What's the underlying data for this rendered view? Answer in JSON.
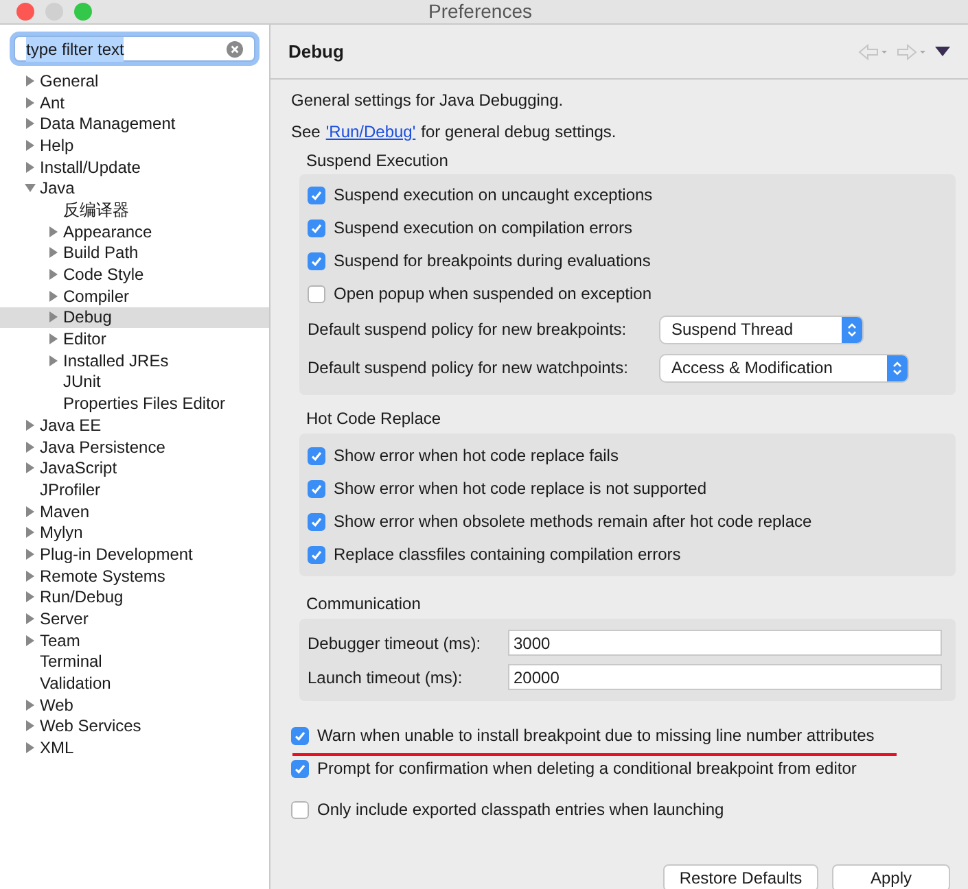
{
  "window": {
    "title": "Preferences"
  },
  "filter": {
    "value": "type filter text"
  },
  "tree": [
    {
      "label": "General",
      "kind": "branch",
      "expanded": false,
      "selected": false
    },
    {
      "label": "Ant",
      "kind": "branch",
      "expanded": false,
      "selected": false
    },
    {
      "label": "Data Management",
      "kind": "branch",
      "expanded": false,
      "selected": false
    },
    {
      "label": "Help",
      "kind": "branch",
      "expanded": false,
      "selected": false
    },
    {
      "label": "Install/Update",
      "kind": "branch",
      "expanded": false,
      "selected": false
    },
    {
      "label": "Java",
      "kind": "branch",
      "expanded": true,
      "selected": false,
      "children": [
        {
          "label": "反编译器",
          "kind": "leaf",
          "selected": false
        },
        {
          "label": "Appearance",
          "kind": "branch",
          "expanded": false,
          "selected": false
        },
        {
          "label": "Build Path",
          "kind": "branch",
          "expanded": false,
          "selected": false
        },
        {
          "label": "Code Style",
          "kind": "branch",
          "expanded": false,
          "selected": false
        },
        {
          "label": "Compiler",
          "kind": "branch",
          "expanded": false,
          "selected": false
        },
        {
          "label": "Debug",
          "kind": "branch",
          "expanded": false,
          "selected": true
        },
        {
          "label": "Editor",
          "kind": "branch",
          "expanded": false,
          "selected": false
        },
        {
          "label": "Installed JREs",
          "kind": "branch",
          "expanded": false,
          "selected": false
        },
        {
          "label": "JUnit",
          "kind": "leaf",
          "selected": false
        },
        {
          "label": "Properties Files Editor",
          "kind": "leaf",
          "selected": false
        }
      ]
    },
    {
      "label": "Java EE",
      "kind": "branch",
      "expanded": false,
      "selected": false
    },
    {
      "label": "Java Persistence",
      "kind": "branch",
      "expanded": false,
      "selected": false
    },
    {
      "label": "JavaScript",
      "kind": "branch",
      "expanded": false,
      "selected": false
    },
    {
      "label": "JProfiler",
      "kind": "leaf",
      "selected": false
    },
    {
      "label": "Maven",
      "kind": "branch",
      "expanded": false,
      "selected": false
    },
    {
      "label": "Mylyn",
      "kind": "branch",
      "expanded": false,
      "selected": false
    },
    {
      "label": "Plug-in Development",
      "kind": "branch",
      "expanded": false,
      "selected": false
    },
    {
      "label": "Remote Systems",
      "kind": "branch",
      "expanded": false,
      "selected": false
    },
    {
      "label": "Run/Debug",
      "kind": "branch",
      "expanded": false,
      "selected": false
    },
    {
      "label": "Server",
      "kind": "branch",
      "expanded": false,
      "selected": false
    },
    {
      "label": "Team",
      "kind": "branch",
      "expanded": false,
      "selected": false
    },
    {
      "label": "Terminal",
      "kind": "leaf",
      "selected": false
    },
    {
      "label": "Validation",
      "kind": "leaf",
      "selected": false
    },
    {
      "label": "Web",
      "kind": "branch",
      "expanded": false,
      "selected": false
    },
    {
      "label": "Web Services",
      "kind": "branch",
      "expanded": false,
      "selected": false
    },
    {
      "label": "XML",
      "kind": "branch",
      "expanded": false,
      "selected": false
    }
  ],
  "page": {
    "title": "Debug",
    "description": "General settings for Java Debugging.",
    "see_prefix": "See",
    "see_link": "'Run/Debug'",
    "see_suffix": "for general debug settings."
  },
  "suspend_execution": {
    "title": "Suspend Execution",
    "options": [
      {
        "label": "Suspend execution on uncaught exceptions",
        "checked": true
      },
      {
        "label": "Suspend execution on compilation errors",
        "checked": true
      },
      {
        "label": "Suspend for breakpoints during evaluations",
        "checked": true
      },
      {
        "label": "Open popup when suspended on exception",
        "checked": false
      }
    ],
    "selects": [
      {
        "label": "Default suspend policy for new breakpoints:",
        "value": "Suspend Thread"
      },
      {
        "label": "Default suspend policy for new watchpoints:",
        "value": "Access & Modification"
      }
    ]
  },
  "hot_code_replace": {
    "title": "Hot Code Replace",
    "options": [
      {
        "label": "Show error when hot code replace fails",
        "checked": true
      },
      {
        "label": "Show error when hot code replace is not supported",
        "checked": true
      },
      {
        "label": "Show error when obsolete methods remain after hot code replace",
        "checked": true
      },
      {
        "label": "Replace classfiles containing compilation errors",
        "checked": true
      }
    ]
  },
  "communication": {
    "title": "Communication",
    "fields": [
      {
        "label": "Debugger timeout (ms):",
        "value": "3000"
      },
      {
        "label": "Launch timeout (ms):",
        "value": "20000"
      }
    ]
  },
  "options": [
    {
      "label": "Warn when unable to install breakpoint due to missing line number attributes",
      "checked": true,
      "underlined": true
    },
    {
      "label": "Prompt for confirmation when deleting a conditional breakpoint from editor",
      "checked": true,
      "underlined": false
    },
    {
      "label": "Only include exported classpath entries when launching",
      "checked": false,
      "underlined": false
    }
  ],
  "buttons": [
    "Restore Defaults",
    "Apply"
  ]
}
